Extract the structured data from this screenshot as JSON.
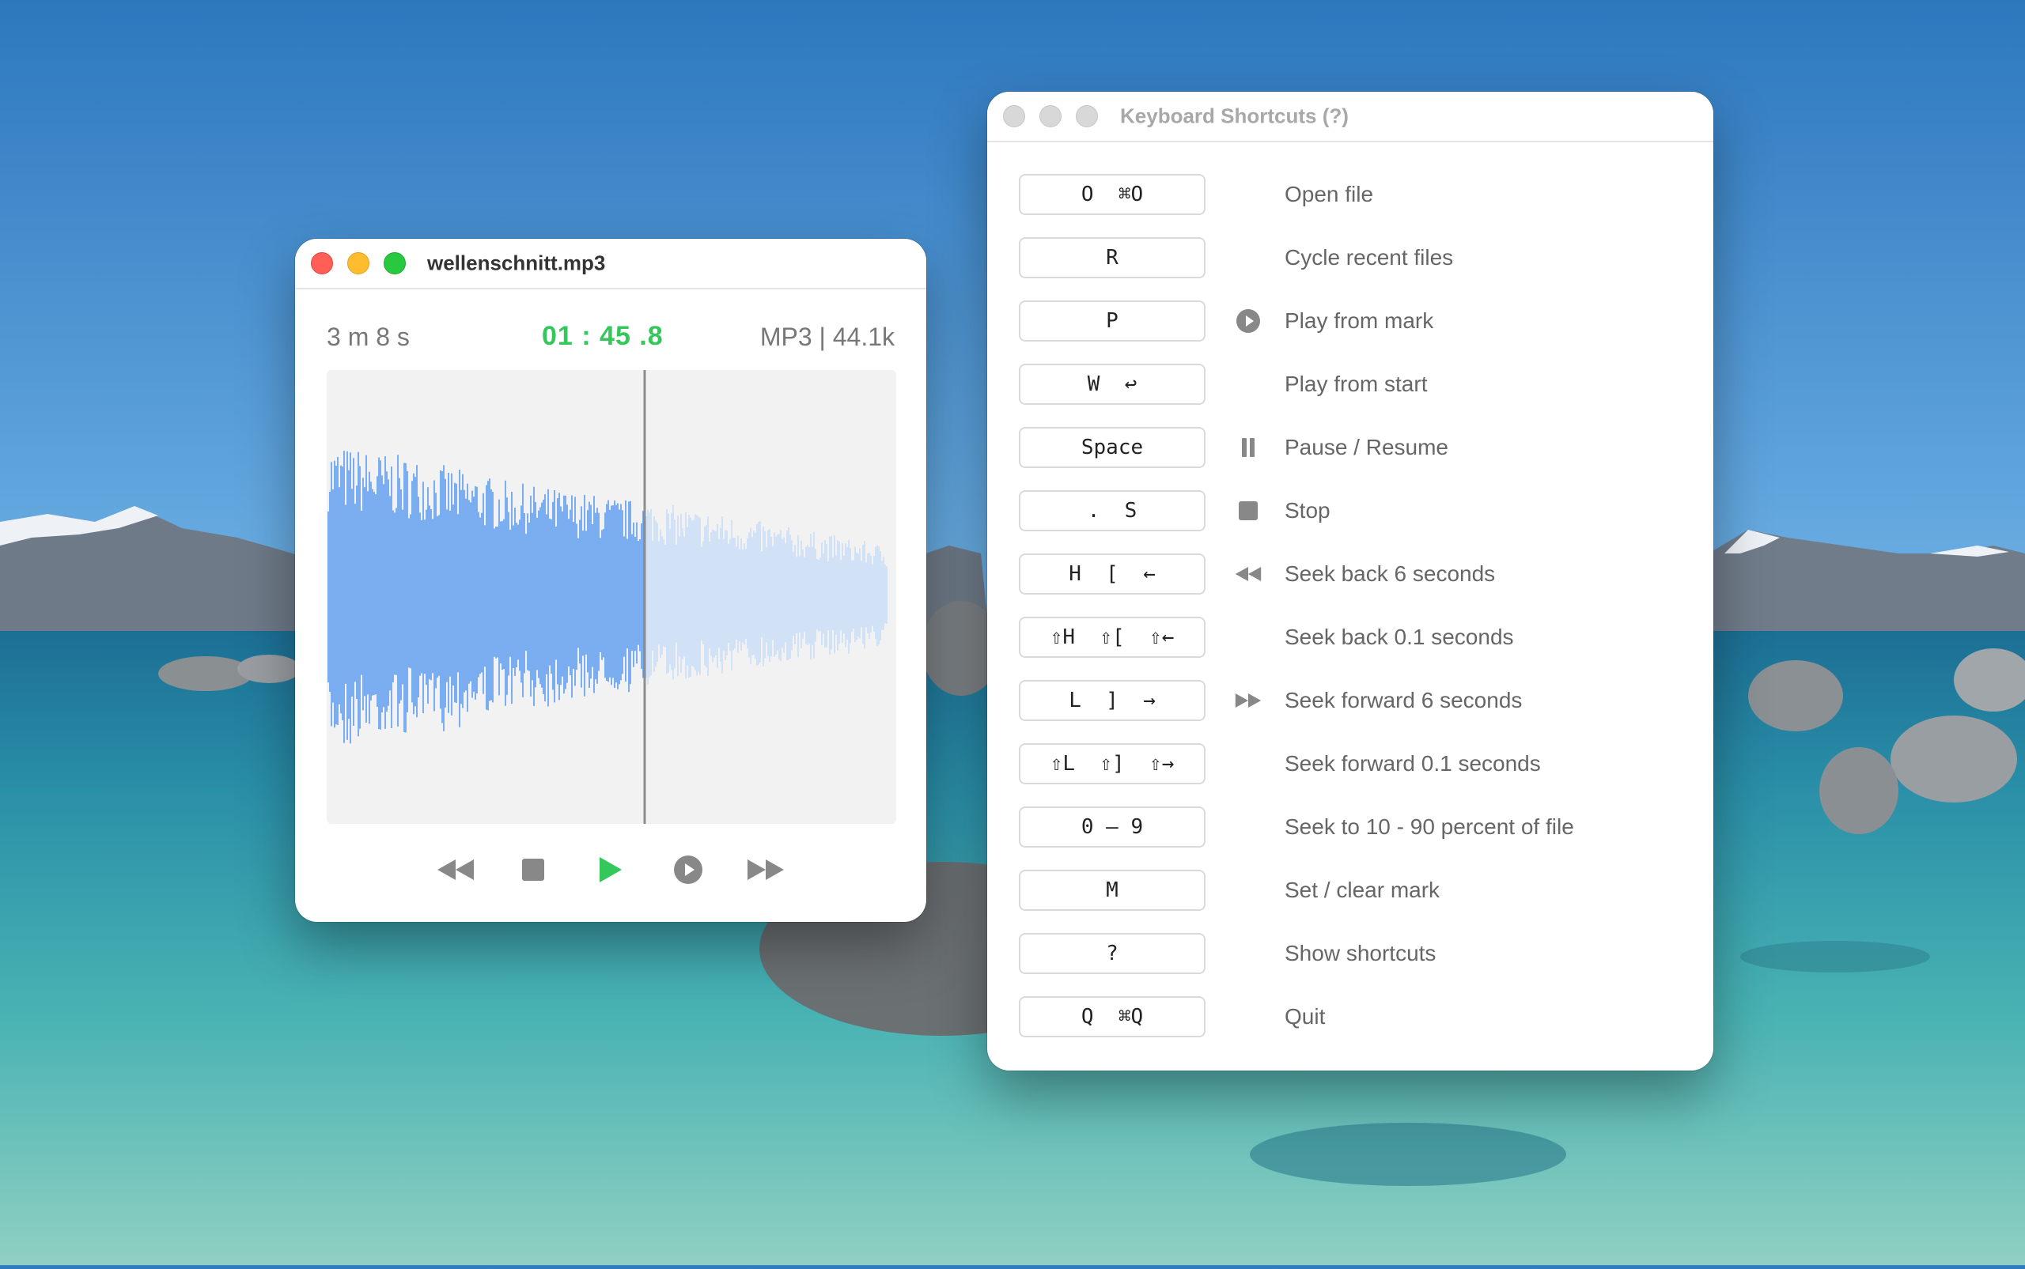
{
  "colors": {
    "accent_green": "#34c759",
    "waveform_played": "#5b9cf0",
    "waveform_unplayed": "#c9ddf7",
    "icon_gray": "#888888"
  },
  "player": {
    "title": "wellenschnitt.mp3",
    "duration": "3 m 8 s",
    "timecode": "01 : 45 .8",
    "format": "MP3 | 44.1k",
    "progress": 0.56,
    "transport": [
      {
        "name": "rewind-icon"
      },
      {
        "name": "stop-icon"
      },
      {
        "name": "play-icon"
      },
      {
        "name": "play-from-mark-icon"
      },
      {
        "name": "fast-forward-icon"
      }
    ]
  },
  "shortcuts": {
    "title": "Keyboard Shortcuts (?)",
    "rows": [
      {
        "key": "O  ⌘O",
        "icon": "",
        "label": "Open file"
      },
      {
        "key": "R",
        "icon": "",
        "label": "Cycle recent files"
      },
      {
        "key": "P",
        "icon": "play-circle-icon",
        "label": "Play from mark"
      },
      {
        "key": "W  ↩",
        "icon": "",
        "label": "Play from start"
      },
      {
        "key": "Space",
        "icon": "pause-icon",
        "label": "Pause / Resume"
      },
      {
        "key": ".  S",
        "icon": "stop-icon",
        "label": "Stop"
      },
      {
        "key": "H  [  ←",
        "icon": "rewind-icon",
        "label": "Seek back 6 seconds"
      },
      {
        "key": "⇧H  ⇧[  ⇧←",
        "icon": "",
        "label": "Seek back 0.1 seconds"
      },
      {
        "key": "L  ]  →",
        "icon": "fast-forward-icon",
        "label": "Seek forward 6 seconds"
      },
      {
        "key": "⇧L  ⇧]  ⇧→",
        "icon": "",
        "label": "Seek forward 0.1 seconds"
      },
      {
        "key": "0 – 9",
        "icon": "",
        "label": "Seek to 10 - 90 percent of file"
      },
      {
        "key": "M",
        "icon": "",
        "label": "Set / clear mark"
      },
      {
        "key": "?",
        "icon": "",
        "label": "Show shortcuts"
      },
      {
        "key": "Q  ⌘Q",
        "icon": "",
        "label": "Quit"
      }
    ]
  }
}
